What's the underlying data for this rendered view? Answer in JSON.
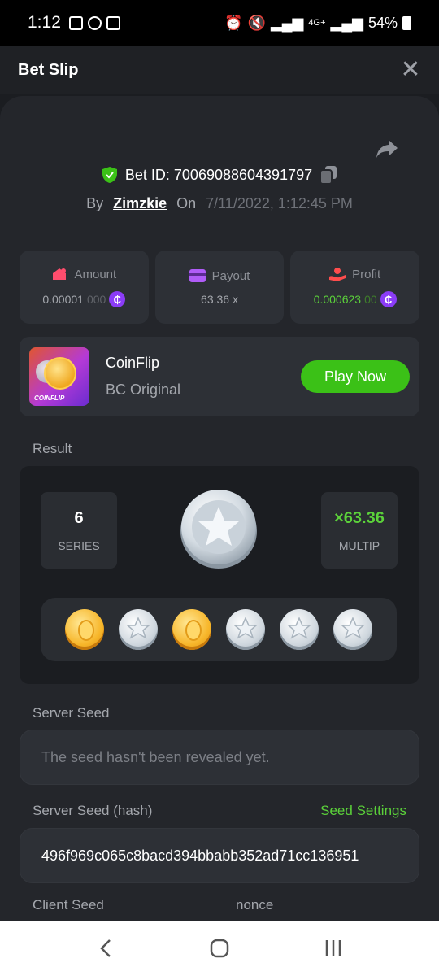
{
  "status_bar": {
    "time": "1:12",
    "network": "4G+",
    "battery": "54%"
  },
  "header": {
    "title": "Bet Slip"
  },
  "bet": {
    "id_label": "Bet ID: 70069088604391797",
    "by_label": "By",
    "username": "Zimzkie",
    "on_label": "On",
    "date": "7/11/2022, 1:12:45 PM"
  },
  "stats": [
    {
      "label": "Amount",
      "value_strong": "0.00001",
      "value_dim": "000",
      "coin": "₵",
      "color": "#ff4d6d"
    },
    {
      "label": "Payout",
      "value_strong": "63.36 x",
      "value_dim": "",
      "coin": "",
      "color": "#b05cf8"
    },
    {
      "label": "Profit",
      "value_strong": "0.000623",
      "value_dim": "00",
      "coin": "₵",
      "color": "#ff4d4d"
    }
  ],
  "game": {
    "name": "CoinFlip",
    "subtitle": "BC Original",
    "thumb_tag": "COINFLIP",
    "play_label": "Play Now"
  },
  "result": {
    "section_label": "Result",
    "series_value": "6",
    "series_label": "SERIES",
    "multiplier_value": "×63.36",
    "multiplier_label": "MULTIP",
    "coins": [
      "gold",
      "silver",
      "gold",
      "silver",
      "silver",
      "silver"
    ]
  },
  "server_seed": {
    "label": "Server Seed",
    "placeholder": "The seed hasn't been revealed yet."
  },
  "server_seed_hash": {
    "label": "Server Seed (hash)",
    "settings_link": "Seed Settings",
    "value": "496f969c065c8bacd394bbabb352ad71cc136951"
  },
  "client_seed": {
    "label": "Client Seed",
    "nonce_label": "nonce"
  },
  "colors": {
    "accent_green": "#3bc117",
    "bg": "#1b1d21",
    "card": "#2d3036"
  }
}
